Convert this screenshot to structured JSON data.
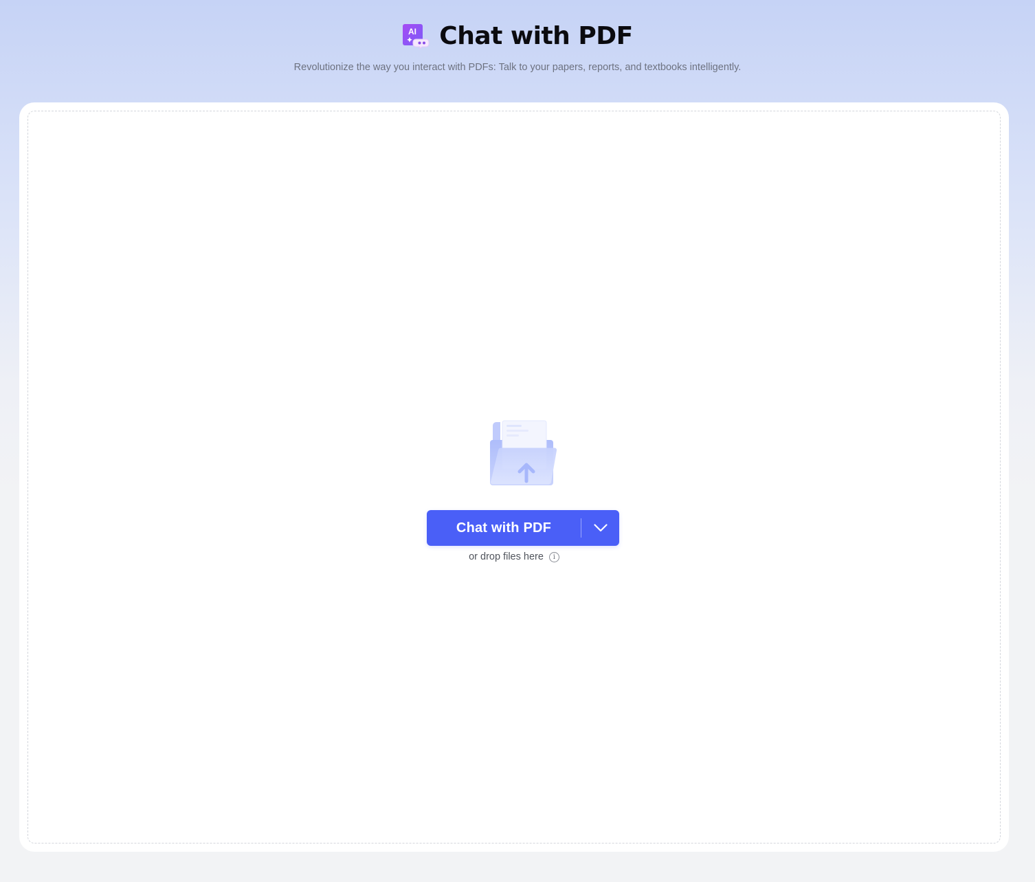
{
  "header": {
    "logo_icon": "ai-chat-pdf-logo-icon",
    "logo_text": "AI",
    "title": "Chat with PDF",
    "subtitle": "Revolutionize the way you interact with PDFs: Talk to your papers, reports, and textbooks intelligently."
  },
  "upload": {
    "illustration_icon": "folder-upload-icon",
    "primary_button_label": "Chat with PDF",
    "dropdown_icon": "chevron-down-icon",
    "drop_hint": "or drop files here",
    "info_icon": "info-icon",
    "info_glyph": "i"
  },
  "colors": {
    "accent": "#4a5ff7",
    "logo_gradient_start": "#a64bf4",
    "logo_gradient_end": "#7b5cf7",
    "header_bg": "#c6d3f6",
    "page_bg": "#f2f3f5"
  }
}
